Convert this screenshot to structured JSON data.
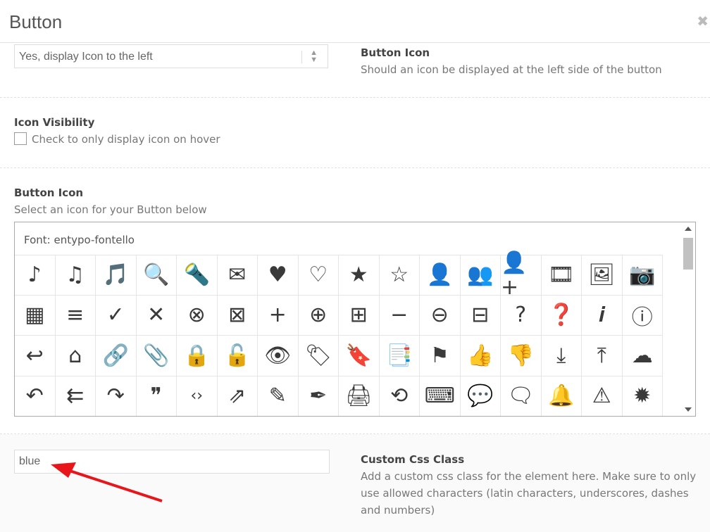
{
  "header": {
    "title": "Button",
    "close_icon": "close-icon"
  },
  "icon_position": {
    "select_value": "Yes, display Icon to the left",
    "label": "Button Icon",
    "description": "Should an icon be displayed at the left side of the button"
  },
  "icon_visibility": {
    "label": "Icon Visibility",
    "checkbox_label": "Check to only display icon on hover",
    "checked": false
  },
  "icon_picker": {
    "label": "Button Icon",
    "description": "Select an icon for your Button below",
    "font_label": "Font: entypo-fontello",
    "selected_icon": "thumbs-up-icon",
    "selected_color": "#e2541b",
    "icons": [
      {
        "name": "note-icon",
        "glyph": "♪"
      },
      {
        "name": "music-icon",
        "glyph": "♫"
      },
      {
        "name": "music-file-icon",
        "glyph": "🎵"
      },
      {
        "name": "search-icon",
        "glyph": "🔍"
      },
      {
        "name": "flashlight-icon",
        "glyph": "🔦"
      },
      {
        "name": "mail-icon",
        "glyph": "✉"
      },
      {
        "name": "heart-icon",
        "glyph": "♥"
      },
      {
        "name": "heart-outline-icon",
        "glyph": "♡"
      },
      {
        "name": "star-icon",
        "glyph": "★"
      },
      {
        "name": "star-outline-icon",
        "glyph": "☆"
      },
      {
        "name": "user-icon",
        "glyph": "👤"
      },
      {
        "name": "users-icon",
        "glyph": "👥"
      },
      {
        "name": "add-user-icon",
        "glyph": "👤+"
      },
      {
        "name": "video-icon",
        "glyph": "🎞"
      },
      {
        "name": "picture-icon",
        "glyph": "🖼"
      },
      {
        "name": "camera-icon",
        "glyph": "📷"
      },
      {
        "name": "grid-icon",
        "glyph": "▦"
      },
      {
        "name": "list-icon",
        "glyph": "≡"
      },
      {
        "name": "check-icon",
        "glyph": "✓"
      },
      {
        "name": "cancel-icon",
        "glyph": "✕"
      },
      {
        "name": "cancel-circle-icon",
        "glyph": "⊗"
      },
      {
        "name": "cancel-square-icon",
        "glyph": "⊠"
      },
      {
        "name": "plus-icon",
        "glyph": "+"
      },
      {
        "name": "plus-circle-icon",
        "glyph": "⊕"
      },
      {
        "name": "plus-square-icon",
        "glyph": "⊞"
      },
      {
        "name": "minus-icon",
        "glyph": "−"
      },
      {
        "name": "minus-circle-icon",
        "glyph": "⊖"
      },
      {
        "name": "minus-square-icon",
        "glyph": "⊟"
      },
      {
        "name": "help-icon",
        "glyph": "?"
      },
      {
        "name": "help-circle-icon",
        "glyph": "❓"
      },
      {
        "name": "info-icon",
        "glyph": "𝒊"
      },
      {
        "name": "info-circle-icon",
        "glyph": "ⓘ"
      },
      {
        "name": "back-icon",
        "glyph": "↩"
      },
      {
        "name": "home-icon",
        "glyph": "⌂"
      },
      {
        "name": "link-icon",
        "glyph": "🔗"
      },
      {
        "name": "attach-icon",
        "glyph": "📎"
      },
      {
        "name": "lock-icon",
        "glyph": "🔒"
      },
      {
        "name": "lock-open-icon",
        "glyph": "🔓"
      },
      {
        "name": "eye-icon",
        "glyph": "👁"
      },
      {
        "name": "tag-icon",
        "glyph": "🏷"
      },
      {
        "name": "bookmark-icon",
        "glyph": "🔖"
      },
      {
        "name": "bookmarks-icon",
        "glyph": "📑"
      },
      {
        "name": "flag-icon",
        "glyph": "⚑"
      },
      {
        "name": "thumbs-up-icon",
        "glyph": "👍"
      },
      {
        "name": "thumbs-down-icon",
        "glyph": "👎"
      },
      {
        "name": "download-icon",
        "glyph": "⤓"
      },
      {
        "name": "upload-icon",
        "glyph": "⤒"
      },
      {
        "name": "upload-cloud-icon",
        "glyph": "☁"
      },
      {
        "name": "reply-icon",
        "glyph": "↶"
      },
      {
        "name": "reply-all-icon",
        "glyph": "⇇"
      },
      {
        "name": "forward-icon",
        "glyph": "↷"
      },
      {
        "name": "quote-icon",
        "glyph": "❞"
      },
      {
        "name": "code-icon",
        "glyph": "‹›"
      },
      {
        "name": "export-icon",
        "glyph": "⇗"
      },
      {
        "name": "pencil-icon",
        "glyph": "✎"
      },
      {
        "name": "feather-icon",
        "glyph": "✒"
      },
      {
        "name": "print-icon",
        "glyph": "🖨"
      },
      {
        "name": "retweet-icon",
        "glyph": "⟲"
      },
      {
        "name": "keyboard-icon",
        "glyph": "⌨"
      },
      {
        "name": "comment-icon",
        "glyph": "💬"
      },
      {
        "name": "chat-icon",
        "glyph": "🗨"
      },
      {
        "name": "bell-icon",
        "glyph": "🔔"
      },
      {
        "name": "attention-icon",
        "glyph": "⚠"
      },
      {
        "name": "alert-icon",
        "glyph": "✹"
      }
    ]
  },
  "custom_css": {
    "value": "blue",
    "label": "Custom Css Class",
    "description": "Add a custom css class for the element here. Make sure to only use allowed characters (latin characters, underscores, dashes and numbers)"
  },
  "annotation": {
    "arrow_color": "#e8161b"
  }
}
